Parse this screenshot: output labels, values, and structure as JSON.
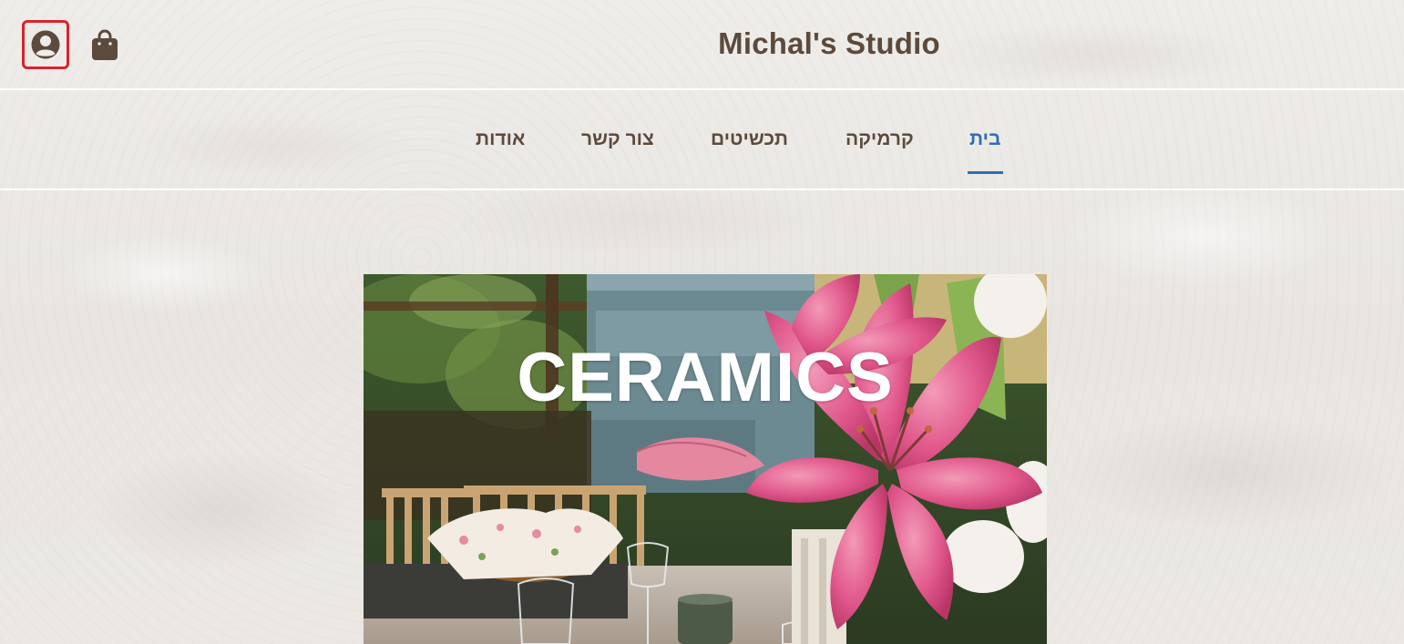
{
  "header": {
    "title": "Michal's Studio",
    "account_icon": "user-circle-icon",
    "cart_icon": "shopping-bag-icon"
  },
  "nav": {
    "items": [
      {
        "label": "בית",
        "active": true
      },
      {
        "label": "קרמיקה",
        "active": false
      },
      {
        "label": "תכשיטים",
        "active": false
      },
      {
        "label": "צור קשר",
        "active": false
      },
      {
        "label": "אודות",
        "active": false
      }
    ]
  },
  "hero": {
    "title": "CERAMICS"
  },
  "colors": {
    "brand_text": "#5c4a3d",
    "active_link": "#2f6db5",
    "focus_outline": "#d9232e",
    "background": "#ece9e5"
  }
}
